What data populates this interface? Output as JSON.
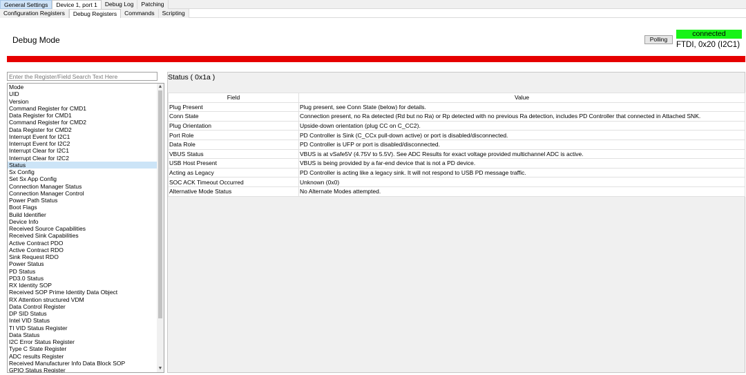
{
  "tabs_top": [
    "General Settings",
    "Device 1, port 1",
    "Debug Log",
    "Patching"
  ],
  "tabs_sub": [
    "Configuration Registers",
    "Debug Registers",
    "Commands",
    "Scripting"
  ],
  "page_title": "Debug Mode",
  "polling_label": "Polling",
  "connection": {
    "status": "connected",
    "info": "FTDI, 0x20 (I2C1)",
    "status_color": "#17f317"
  },
  "alert_bar_color": "#e60000",
  "search": {
    "placeholder": "Enter the Register/Field Search Text Here",
    "value": ""
  },
  "registers": [
    "Mode",
    "UID",
    "Version",
    "Command Register for CMD1",
    "Data Register for CMD1",
    "Command Register for CMD2",
    "Data Register for CMD2",
    "Interrupt Event for I2C1",
    "Interrupt Event for I2C2",
    "Interrupt Clear for I2C1",
    "Interrupt Clear for I2C2",
    "Status",
    "Sx Config",
    "Set Sx App Config",
    "Connection Manager Status",
    "Connection Manager Control",
    "Power Path Status",
    "Boot Flags",
    "Build Identifier",
    "Device Info",
    "Received Source Capabilities",
    "Received Sink Capabilities",
    "Active Contract PDO",
    "Active Contract RDO",
    "Sink Request RDO",
    "Power Status",
    "PD Status",
    "PD3.0 Status",
    "RX Identity SOP",
    "Received SOP Prime Identity Data Object",
    "RX Attention structured VDM",
    "Data Control Register",
    "DP SID Status",
    "Intel VID Status",
    "TI VID Status Register",
    "Data Status",
    "I2C Error Status Register",
    "Type C State Register",
    "ADC results Register",
    "Received Manufacturer Info Data Block SOP",
    "GPIO Status Register"
  ],
  "selected_register": "Status",
  "detail": {
    "title": "Status  ( 0x1a )",
    "columns": {
      "field": "Field",
      "value": "Value"
    },
    "rows": [
      {
        "field": "Plug Present",
        "value": "Plug present, see Conn State (below) for details."
      },
      {
        "field": "Conn State",
        "value": "Connection present, no Ra detected (Rd but no Ra) or Rp detected with no previous Ra detection, includes PD Controller that connected in Attached SNK."
      },
      {
        "field": "Plug Orientation",
        "value": "Upside-down orientation (plug CC on C_CC2)."
      },
      {
        "field": "Port Role",
        "value": "PD Controller is Sink (C_CCx pull-down active) or port is disabled/disconnected."
      },
      {
        "field": "Data Role",
        "value": "PD Controller is UFP or port is disabled/disconnected."
      },
      {
        "field": "VBUS Status",
        "value": "VBUS is at vSafe5V (4.75V to 5.5V). See ADC Results for exact voltage provided multichannel ADC is active."
      },
      {
        "field": "USB Host Present",
        "value": "VBUS is being provided by a far-end device that is not a PD device."
      },
      {
        "field": "Acting as Legacy",
        "value": "PD Controller is acting like a legacy sink. It will not respond to USB PD message traffic."
      },
      {
        "field": "SOC ACK Timeout Occurred",
        "value": "Unknown (0x0)"
      },
      {
        "field": "Alternative Mode Status",
        "value": "No Alternate Modes attempted."
      }
    ]
  }
}
